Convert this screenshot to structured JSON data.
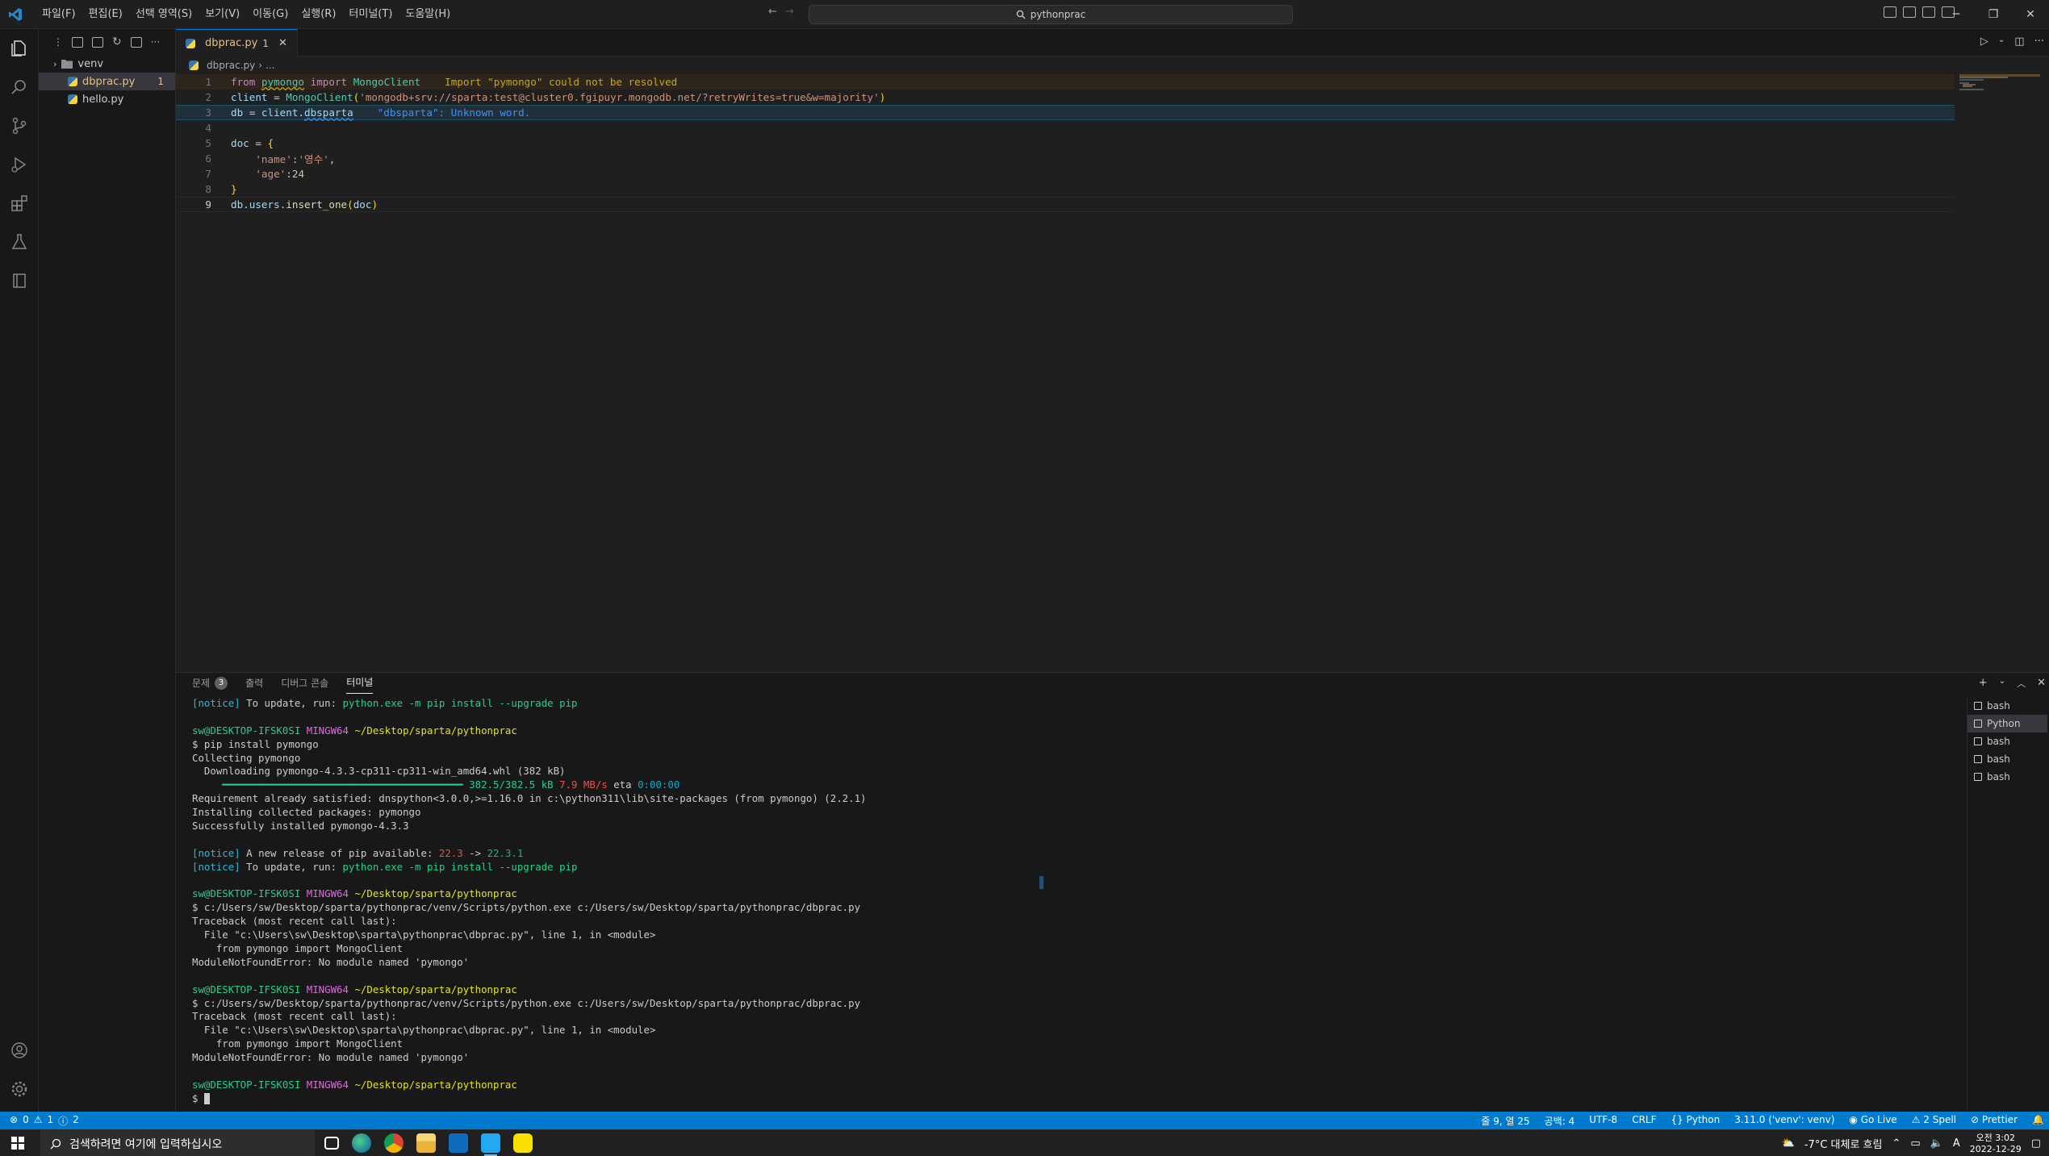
{
  "menu": [
    "파일(F)",
    "편집(E)",
    "선택 영역(S)",
    "보기(V)",
    "이동(G)",
    "실행(R)",
    "터미널(T)",
    "도움말(H)"
  ],
  "search": {
    "text": "pythonprac"
  },
  "sidebar": {
    "items": [
      {
        "label": "venv",
        "type": "folder"
      },
      {
        "label": "dbprac.py",
        "type": "file",
        "badge": "1"
      },
      {
        "label": "hello.py",
        "type": "file"
      }
    ]
  },
  "editor": {
    "tab": {
      "label": "dbprac.py",
      "badge": "1"
    },
    "breadcrumb": {
      "file": "dbprac.py",
      "more": "..."
    },
    "line_numbers": [
      "1",
      "2",
      "3",
      "4",
      "5",
      "6",
      "7",
      "8",
      "9"
    ],
    "line1": {
      "kw_from": "from",
      "mod": "pymongo",
      "kw_import": "import",
      "cls": "MongoClient",
      "diag": "Import \"pymongo\" could not be resolved"
    },
    "line2": {
      "var": "client",
      "eq": " = ",
      "cls": "MongoClient",
      "paren_open": "(",
      "str": "'mongodb+srv://sparta:test@cluster0.fgipuyr.mongodb.net/?retryWrites=true&w=majority'",
      "paren_close": ")"
    },
    "line3": {
      "var": "db",
      "eq": " = ",
      "obj": "client",
      "dot": ".",
      "attr": "dbsparta",
      "diag": "\"dbsparta\": Unknown word."
    },
    "line5": {
      "var": "doc",
      "eq": " = ",
      "brace": "{"
    },
    "line6": {
      "key": "'name'",
      "colon": ":",
      "val": "'영수'",
      "comma": ","
    },
    "line7": {
      "key": "'age'",
      "colon": ":",
      "val": "24"
    },
    "line8": {
      "brace": "}"
    },
    "line9": {
      "obj": "db",
      "dot1": ".",
      "coll": "users",
      "dot2": ".",
      "fn": "insert_one",
      "po": "(",
      "arg": "doc",
      "pc": ")"
    }
  },
  "panel": {
    "tabs": [
      {
        "label": "문제",
        "badge": "3"
      },
      {
        "label": "출력"
      },
      {
        "label": "디버그 콘솔"
      },
      {
        "label": "터미널"
      }
    ],
    "terminals": [
      "bash",
      "Python",
      "bash",
      "bash",
      "bash"
    ],
    "lines": {
      "notice": "[notice]",
      "update_text": " To update, run: ",
      "update_cmd": "python.exe -m pip install --upgrade pip",
      "user": "sw@DESKTOP-IFSK0SI",
      "shell": "MINGW64",
      "path": "~/Desktop/sparta/pythonprac",
      "cmd1": "$ pip install pymongo",
      "collecting": "Collecting pymongo",
      "downloading": "  Downloading pymongo-4.3.3-cp311-cp311-win_amd64.whl (382 kB)",
      "progress_bar": "     ━━━━━━━━━━━━━━━━━━━━━━━━━━━━━━━━━━━━━━━━",
      "progress_size": "382.5/382.5 kB",
      "progress_speed": "7.9 MB/s",
      "progress_eta_label": " eta ",
      "progress_eta": "0:00:00",
      "req_satisfied": "Requirement already satisfied: dnspython<3.0.0,>=1.16.0 in c:\\python311\\lib\\site-packages (from pymongo) (2.2.1)",
      "installing": "Installing collected packages: pymongo",
      "installed": "Successfully installed pymongo-4.3.3",
      "new_release": " A new release of pip available: ",
      "old_ver": "22.3",
      "arrow": " -> ",
      "new_ver": "22.3.1",
      "run_cmd": "$ c:/Users/sw/Desktop/sparta/pythonprac/venv/Scripts/python.exe c:/Users/sw/Desktop/sparta/pythonprac/dbprac.py",
      "traceback": "Traceback (most recent call last):",
      "file_line": "  File \"c:\\Users\\sw\\Desktop\\sparta\\pythonprac\\dbprac.py\", line 1, in <module>",
      "from_line": "    from pymongo import MongoClient",
      "error": "ModuleNotFoundError: No module named 'pymongo'",
      "prompt": "$ "
    }
  },
  "statusbar": {
    "errors": "0",
    "warnings": "1",
    "infos": "2",
    "position": "줄 9, 열 25",
    "spaces": "공백: 4",
    "encoding": "UTF-8",
    "eol": "CRLF",
    "language": "Python",
    "interpreter": "3.11.0 ('venv': venv)",
    "golive": "Go Live",
    "spell": "2 Spell",
    "prettier": "Prettier"
  },
  "taskbar": {
    "search_placeholder": "검색하려면 여기에 입력하십시오",
    "weather": "-7°C 대체로 흐림",
    "ime": "A",
    "time": "오전 3:02",
    "date": "2022-12-29"
  },
  "colors": {
    "accent": "#007acc",
    "warning": "#cca700",
    "info": "#3794ff",
    "terminal_green": "#23d18b",
    "terminal_yellow": "#e5e510",
    "terminal_magenta": "#d670d6"
  }
}
